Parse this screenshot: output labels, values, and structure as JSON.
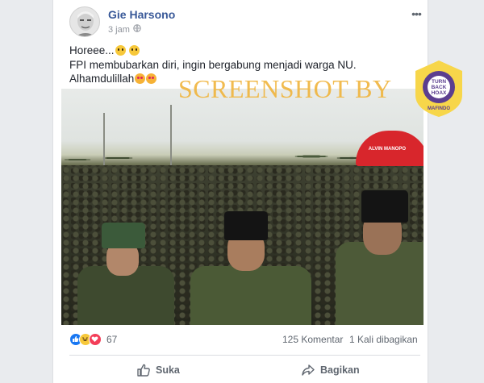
{
  "post": {
    "author": "Gie Harsono",
    "time": "3 jam",
    "lines": [
      "Horeee...",
      "FPI membubarkan diri, ingin bergabung menjadi warga NU.",
      "Alhamdulillah"
    ]
  },
  "photo": {
    "watermark": "SCREENSHOT BY",
    "badge": {
      "ring_text": "MASYARAKAT ANTI FITNAH INDONESIA",
      "center_lines": [
        "TURN",
        "BACK",
        "HOAX"
      ],
      "bottom_text": "MAFINDO"
    },
    "umbrella_text": "ALVIN MANOPO"
  },
  "stats": {
    "reaction_count": "67",
    "comments": "125 Komentar",
    "shares": "1 Kali dibagikan"
  },
  "actions": {
    "like": "Suka",
    "share": "Bagikan"
  },
  "colors": {
    "name_blue": "#385898",
    "like_blue": "#1877f2",
    "watermark": "#f0b43c",
    "badge_purple": "#5b3e8f",
    "badge_yellow": "#f7d64a"
  }
}
